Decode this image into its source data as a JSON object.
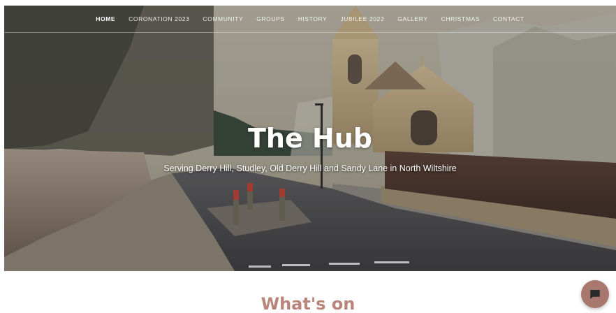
{
  "nav": {
    "items": [
      {
        "label": "HOME",
        "active": true
      },
      {
        "label": "CORONATION 2023",
        "active": false
      },
      {
        "label": "COMMUNITY",
        "active": false
      },
      {
        "label": "GROUPS",
        "active": false
      },
      {
        "label": "HISTORY",
        "active": false
      },
      {
        "label": "JUBILEE 2022",
        "active": false
      },
      {
        "label": "GALLERY",
        "active": false
      },
      {
        "label": "CHRISTMAS",
        "active": false
      },
      {
        "label": "CONTACT",
        "active": false
      }
    ]
  },
  "hero": {
    "title": "The Hub",
    "subtitle": "Serving Derry Hill, Studley, Old Derry Hill and Sandy Lane in North Wiltshire",
    "image": "village-street-with-church"
  },
  "main": {
    "section_heading": "What's on"
  },
  "chat": {
    "icon": "chat-bubble-icon"
  },
  "colors": {
    "heading": "#b9847a",
    "chat_button": "#a8786f",
    "nav_text": "#ffffff"
  }
}
